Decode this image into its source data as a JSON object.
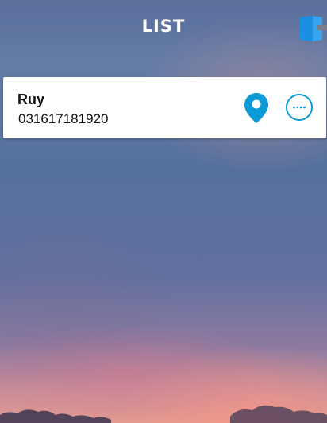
{
  "header": {
    "title": "LIST",
    "exit_icon": "exit-door-icon"
  },
  "contacts": [
    {
      "name": "Ruy",
      "phone": "031617181920",
      "actions": [
        "location-pin-icon",
        "more-options-icon"
      ]
    }
  ],
  "colors": {
    "accent": "#0b9ad6",
    "card_background": "#ffffff",
    "title_text": "#ffffff"
  }
}
